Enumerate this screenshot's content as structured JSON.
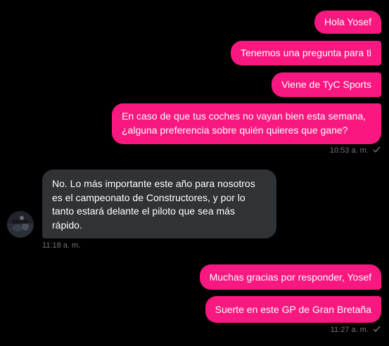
{
  "messages": {
    "sent_group_1": [
      "Hola Yosef",
      "Tenemos una pregunta para ti",
      "Viene de TyC Sports",
      "En caso de que tus coches no vayan bien esta semana, ¿alguna preferencia sobre quién quieres que gane?"
    ],
    "sent_group_1_line1": "En caso de que tus coches no vayan bien esta semana,",
    "sent_group_1_line2": "¿alguna preferencia sobre quién quieres que gane?",
    "sent_group_1_time": "10:53 a. m.",
    "received_1": {
      "line1": "No. Lo más importante este año para nosotros",
      "line2": "es el campeonato de Constructores, y por lo",
      "line3": "tanto estará delante el piloto que sea más",
      "line4": "rápido.",
      "time": "11:18 a. m."
    },
    "sent_group_2": [
      "Muchas gracias por responder, Yosef",
      "Suerte en este GP de Gran Bretaña"
    ],
    "sent_group_2_time": "11:27 a. m."
  },
  "icons": {
    "read_receipt": "check-icon",
    "avatar": "avatar"
  },
  "colors": {
    "sent_bubble": "#f91880",
    "received_bubble": "#2f3336",
    "background": "#000000",
    "timestamp": "#71767b"
  }
}
